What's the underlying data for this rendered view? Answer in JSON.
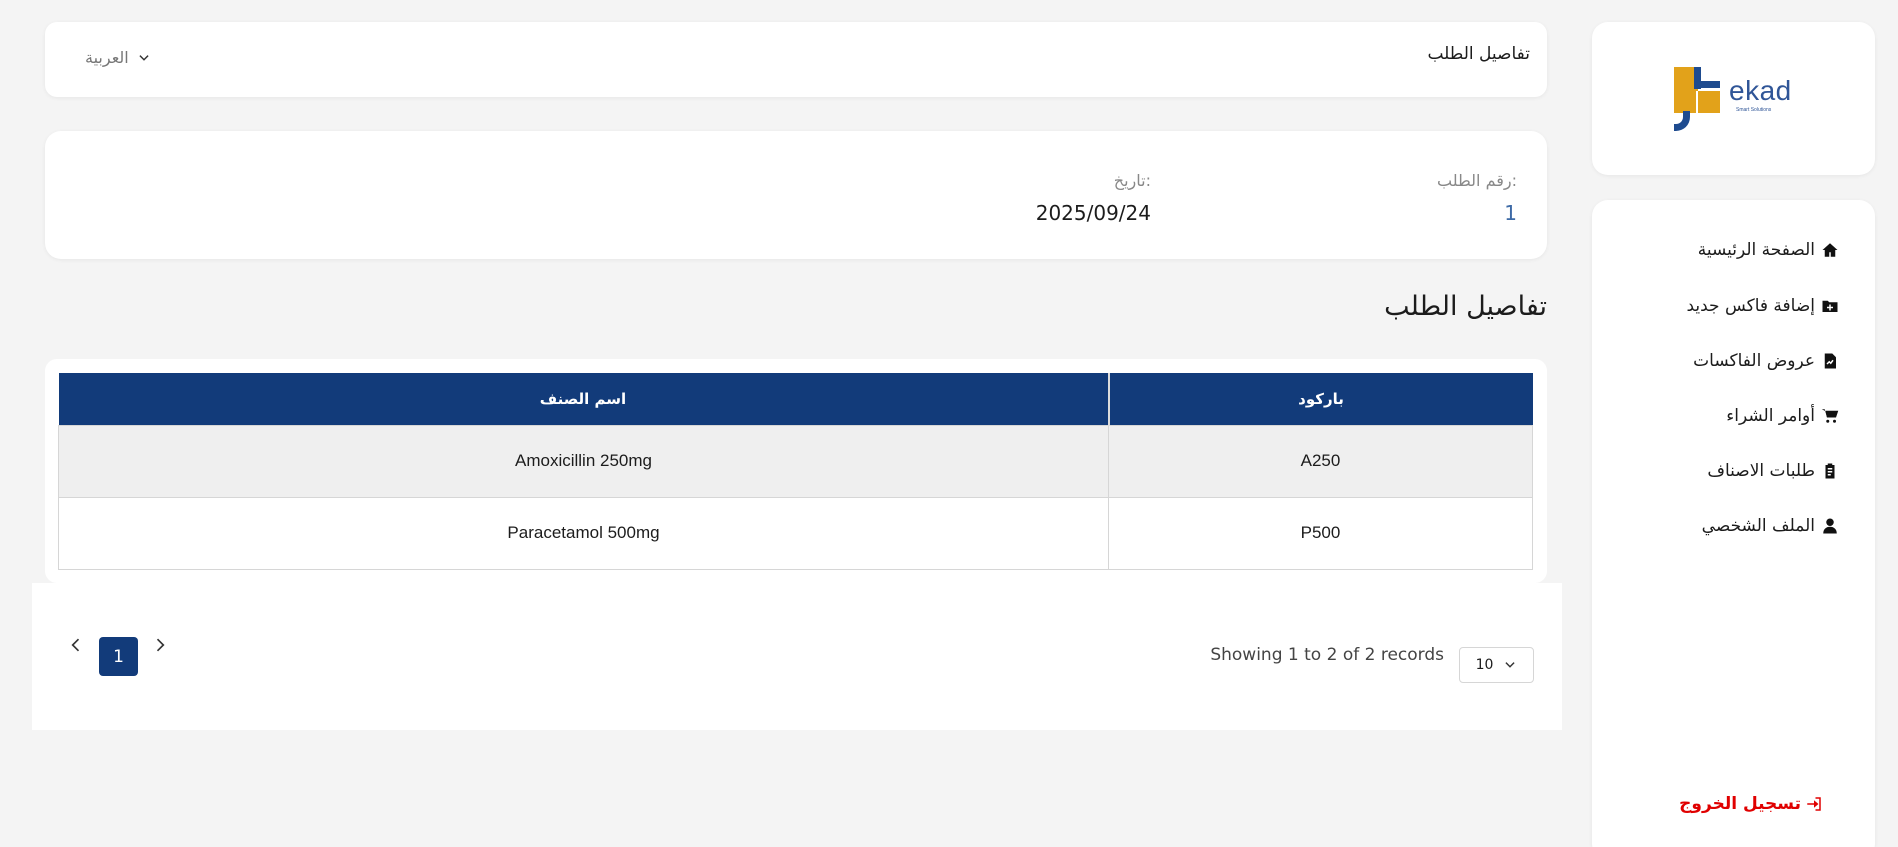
{
  "logo": {
    "word": "ekad",
    "sub": "Smart Solutions"
  },
  "sidebar": {
    "items": [
      {
        "label": "الصفحة الرئيسية",
        "icon": "home-icon"
      },
      {
        "label": "إضافة فاكس جديد",
        "icon": "folder-plus-icon"
      },
      {
        "label": "عروض الفاكسات",
        "icon": "file-chart-icon"
      },
      {
        "label": "أوامر الشراء",
        "icon": "cart-icon"
      },
      {
        "label": "طلبات الاصناف",
        "icon": "clipboard-icon"
      },
      {
        "label": "الملف الشخصي",
        "icon": "user-icon"
      }
    ],
    "logout": "تسجيل الخروج",
    "logout_color": "#e00000"
  },
  "header": {
    "title": "تفاصيل الطلب",
    "language": "العربية"
  },
  "info": {
    "order_label": "رقم الطلب:",
    "order_value": "1",
    "date_label": "تاريخ:",
    "date_value": "2025/09/24"
  },
  "section_title": "تفاصيل الطلب",
  "table": {
    "columns": [
      "باركود",
      "اسم الصنف"
    ],
    "rows": [
      [
        "A250",
        "Amoxicillin 250mg"
      ],
      [
        "P500",
        "Paracetamol 500mg"
      ]
    ],
    "header_color": "#123b7a"
  },
  "pagination": {
    "current_page": "1",
    "showing": "Showing 1 to 2 of 2 records",
    "page_size": "10"
  }
}
